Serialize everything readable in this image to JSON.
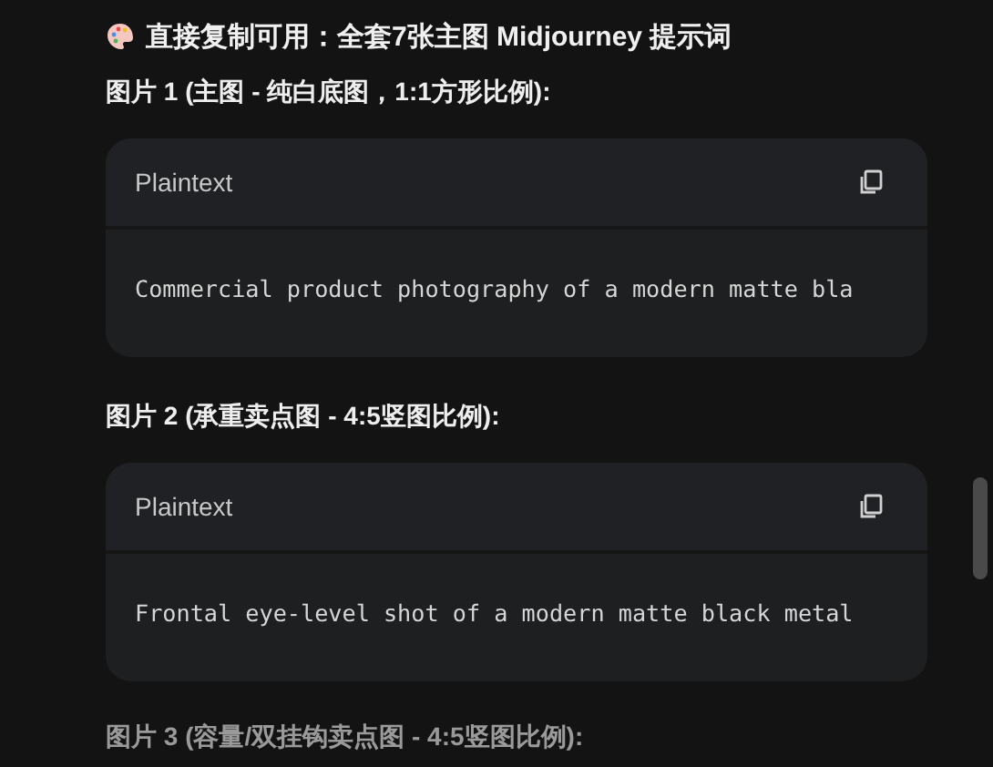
{
  "title": "直接复制可用：全套7张主图 Midjourney 提示词",
  "sections": [
    {
      "heading": "图片 1 (主图 - 纯白底图，1:1方形比例):",
      "code": {
        "language": "Plaintext",
        "text": "Commercial product photography of a modern matte bla"
      }
    },
    {
      "heading": "图片 2 (承重卖点图 - 4:5竖图比例):",
      "code": {
        "language": "Plaintext",
        "text": "Frontal eye-level shot of a modern matte black metal"
      }
    },
    {
      "heading": "图片 3 (容量/双挂钩卖点图 - 4:5竖图比例):",
      "faded": true
    }
  ]
}
